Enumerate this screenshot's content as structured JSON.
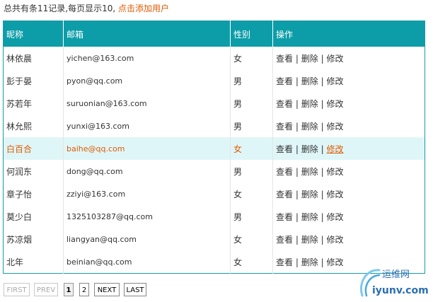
{
  "summary": {
    "text": "总共有条11记录,每页显示10,",
    "add_link": "点击添加用户"
  },
  "table": {
    "headers": [
      "昵称",
      "邮箱",
      "性别",
      "操作"
    ],
    "rows": [
      {
        "nickname": "林依晨",
        "email": "yichen@163.com",
        "gender": "女"
      },
      {
        "nickname": "彭于晏",
        "email": "pyon@qq.com",
        "gender": "男"
      },
      {
        "nickname": "苏若年",
        "email": "suruonian@163.com",
        "gender": "男"
      },
      {
        "nickname": "林允熙",
        "email": "yunxi@163.com",
        "gender": "男"
      },
      {
        "nickname": "白百合",
        "email": "baihe@qq.com",
        "gender": "女"
      },
      {
        "nickname": "何润东",
        "email": "dong@qq.com",
        "gender": "男"
      },
      {
        "nickname": "章子怡",
        "email": "zziyi@163.com",
        "gender": "女"
      },
      {
        "nickname": "莫少白",
        "email": "1325103287@qq.com",
        "gender": "男"
      },
      {
        "nickname": "苏凉烟",
        "email": "liangyan@qq.com",
        "gender": "女"
      },
      {
        "nickname": "北年",
        "email": "beinian@qq.com",
        "gender": "女"
      }
    ],
    "actions": {
      "view": "查看",
      "delete": "删除",
      "edit": "修改",
      "separator": "|"
    }
  },
  "pager": {
    "first": "FIRST",
    "prev": "PREV",
    "page1": "1",
    "page2": "2",
    "next": "NEXT",
    "last": "LAST"
  },
  "watermark": {
    "name": "运维网",
    "domain": "iyunv.com"
  },
  "colors": {
    "header_bg": "#0c9da8",
    "highlight_row_bg": "#dff6f8",
    "link_orange": "#e05a00"
  }
}
